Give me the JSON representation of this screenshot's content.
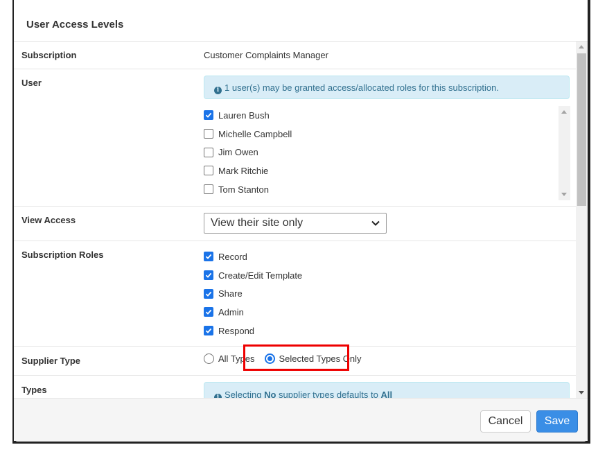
{
  "dialog": {
    "title": "User Access Levels"
  },
  "subscription": {
    "label": "Subscription",
    "value": "Customer Complaints Manager"
  },
  "user": {
    "label": "User",
    "info": "1 user(s) may be granted access/allocated roles for this subscription.",
    "items": [
      {
        "name": "Lauren Bush",
        "checked": true
      },
      {
        "name": "Michelle Campbell",
        "checked": false
      },
      {
        "name": "Jim Owen",
        "checked": false
      },
      {
        "name": "Mark Ritchie",
        "checked": false
      },
      {
        "name": "Tom Stanton",
        "checked": false
      }
    ]
  },
  "view_access": {
    "label": "View Access",
    "selected": "View their site only"
  },
  "roles": {
    "label": "Subscription Roles",
    "items": [
      {
        "name": "Record",
        "checked": true
      },
      {
        "name": "Create/Edit Template",
        "checked": true
      },
      {
        "name": "Share",
        "checked": true
      },
      {
        "name": "Admin",
        "checked": true
      },
      {
        "name": "Respond",
        "checked": true
      }
    ]
  },
  "supplier_type": {
    "label": "Supplier Type",
    "options": [
      {
        "name": "All Types",
        "selected": false
      },
      {
        "name": "Selected Types Only",
        "selected": true
      }
    ]
  },
  "types": {
    "label": "Types",
    "info_prefix": "Selecting ",
    "info_bold1": "No",
    "info_middle": " supplier types defaults to ",
    "info_bold2": "All"
  },
  "footer": {
    "cancel_label": "Cancel",
    "save_label": "Save"
  },
  "colors": {
    "accent": "#1a73e8",
    "save_button": "#3a8ee6",
    "info_background": "#d9edf7",
    "info_text": "#31708f",
    "highlight": "#e00000"
  }
}
